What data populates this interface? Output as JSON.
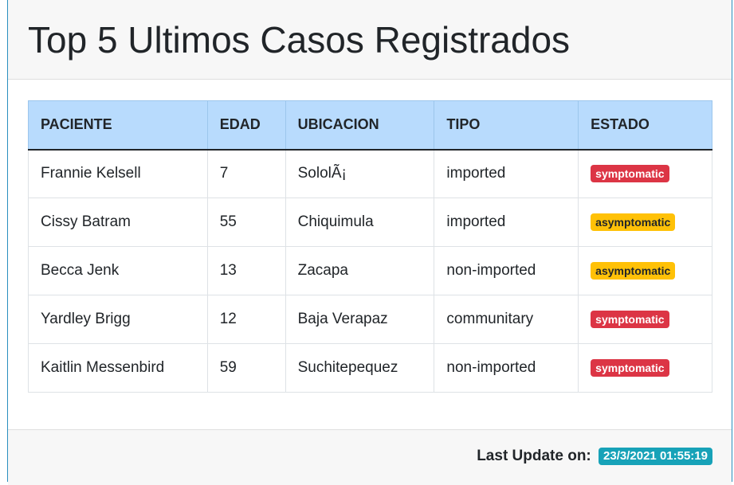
{
  "title": "Top 5 Ultimos Casos Registrados",
  "table": {
    "headers": [
      "PACIENTE",
      "EDAD",
      "UBICACION",
      "TIPO",
      "ESTADO"
    ],
    "rows": [
      {
        "paciente": "Frannie Kelsell",
        "edad": "7",
        "ubicacion": "SololÃ¡",
        "tipo": "imported",
        "estado": "symptomatic"
      },
      {
        "paciente": "Cissy Batram",
        "edad": "55",
        "ubicacion": "Chiquimula",
        "tipo": "imported",
        "estado": "asymptomatic"
      },
      {
        "paciente": "Becca Jenk",
        "edad": "13",
        "ubicacion": "Zacapa",
        "tipo": "non-imported",
        "estado": "asymptomatic"
      },
      {
        "paciente": "Yardley Brigg",
        "edad": "12",
        "ubicacion": "Baja Verapaz",
        "tipo": "communitary",
        "estado": "symptomatic"
      },
      {
        "paciente": "Kaitlin Messenbird",
        "edad": "59",
        "ubicacion": "Suchitepequez",
        "tipo": "non-imported",
        "estado": "symptomatic"
      }
    ]
  },
  "status_colors": {
    "symptomatic": {
      "bg": "#dc3545",
      "fg": "#ffffff"
    },
    "asymptomatic": {
      "bg": "#ffc107",
      "fg": "#212529"
    }
  },
  "footer": {
    "label": "Last Update on:",
    "timestamp": "23/3/2021 01:55:19",
    "badge_color": "#17a2b8"
  }
}
